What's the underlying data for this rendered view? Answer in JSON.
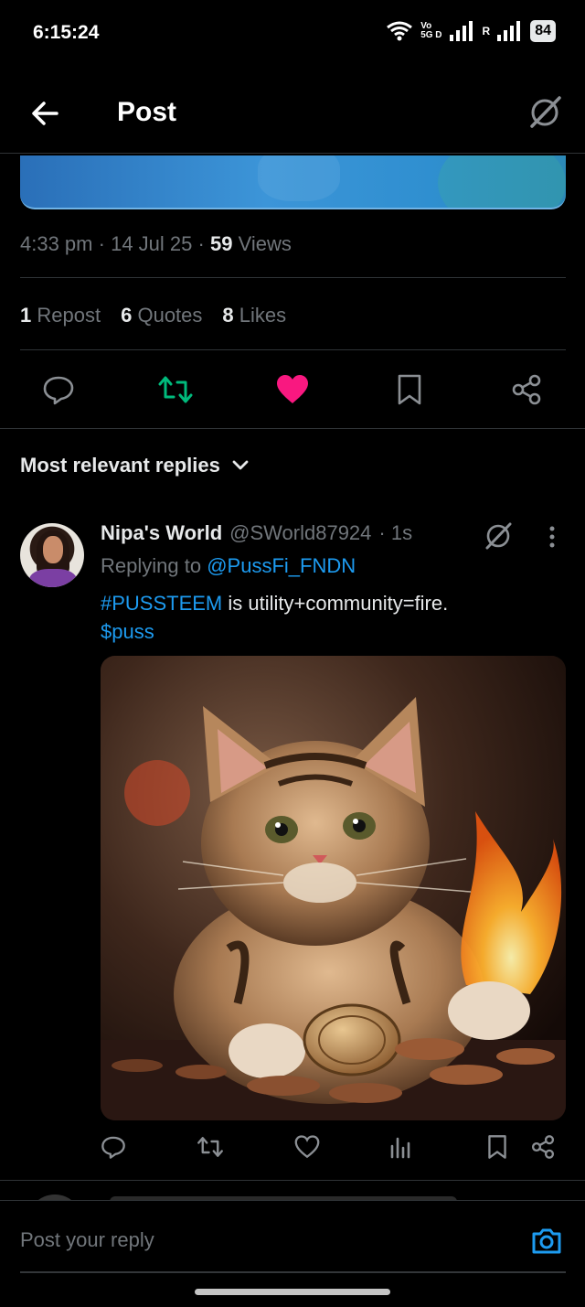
{
  "status_bar": {
    "time": "6:15:24",
    "network_tag_top": "Vo",
    "network_tag_bottom": "5G D",
    "roaming": "R",
    "battery": "84"
  },
  "header": {
    "title": "Post",
    "back_icon": "arrow-left-icon",
    "grok_icon": "grok-slash-icon"
  },
  "post": {
    "time": "4:33 pm",
    "date": "14 Jul 25",
    "views_count": "59",
    "views_label": "Views",
    "reposts_count": "1",
    "reposts_label": "Repost",
    "quotes_count": "6",
    "quotes_label": "Quotes",
    "likes_count": "8",
    "likes_label": "Likes",
    "liked": true,
    "reposted": true,
    "colors": {
      "repost": "#00ba7c",
      "like": "#f91880",
      "link": "#1d9bf0"
    }
  },
  "replies_sort": {
    "label": "Most relevant replies"
  },
  "reply": {
    "name": "Nipa's World",
    "handle": "@SWorld87924",
    "time": "· 1s",
    "replying_prefix": "Replying to",
    "replying_to": "@PussFi_FNDN",
    "hashtag": "#PUSSTEEM",
    "text": " is utility+community=fire.",
    "cashtag": "$puss",
    "image_alt": "kitten with coins and flame"
  },
  "composer": {
    "placeholder": "Post your reply",
    "camera_icon": "camera-icon"
  }
}
